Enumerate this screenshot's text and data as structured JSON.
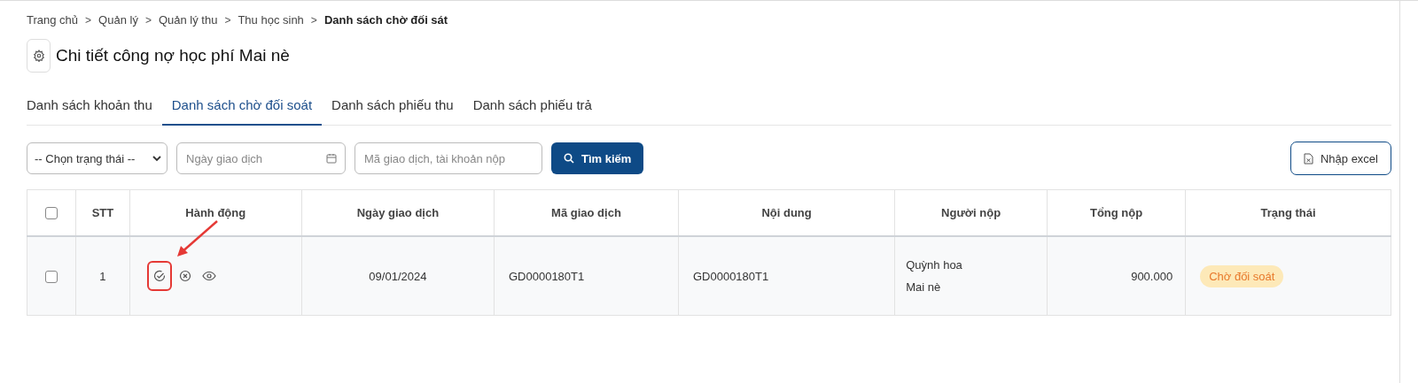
{
  "breadcrumb": [
    {
      "label": "Trang chủ",
      "current": false
    },
    {
      "label": "Quản lý",
      "current": false
    },
    {
      "label": "Quản lý thu",
      "current": false
    },
    {
      "label": "Thu học sinh",
      "current": false
    },
    {
      "label": "Danh sách chờ đối sát",
      "current": true
    }
  ],
  "breadcrumb_separator": ">",
  "title": "Chi tiết công nợ học phí Mai nè",
  "tabs": [
    {
      "label": "Danh sách khoản thu",
      "selected": false
    },
    {
      "label": "Danh sách chờ đối soát",
      "selected": true
    },
    {
      "label": "Danh sách phiếu thu",
      "selected": false
    },
    {
      "label": "Danh sách phiếu trả",
      "selected": false
    }
  ],
  "filters": {
    "status_select": "-- Chọn trạng thái --",
    "date_placeholder": "Ngày giao dịch",
    "search_placeholder": "Mã giao dịch, tài khoản nộp",
    "search_button": "Tìm kiếm",
    "import_button": "Nhập excel"
  },
  "table": {
    "select_all_checked": false,
    "columns": [
      "STT",
      "Hành động",
      "Ngày giao dịch",
      "Mã giao dịch",
      "Nội dung",
      "Người nộp",
      "Tổng nộp",
      "Trạng thái"
    ],
    "rows": [
      {
        "checked": false,
        "stt": "1",
        "date": "09/01/2024",
        "code": "GD0000180T1",
        "content": "GD0000180T1",
        "payers": [
          "Quỳnh hoa",
          "Mai nè"
        ],
        "total": "900.000",
        "status": "Chờ đối soát",
        "color": "#e8792b",
        "highlighted_action": true
      }
    ]
  }
}
